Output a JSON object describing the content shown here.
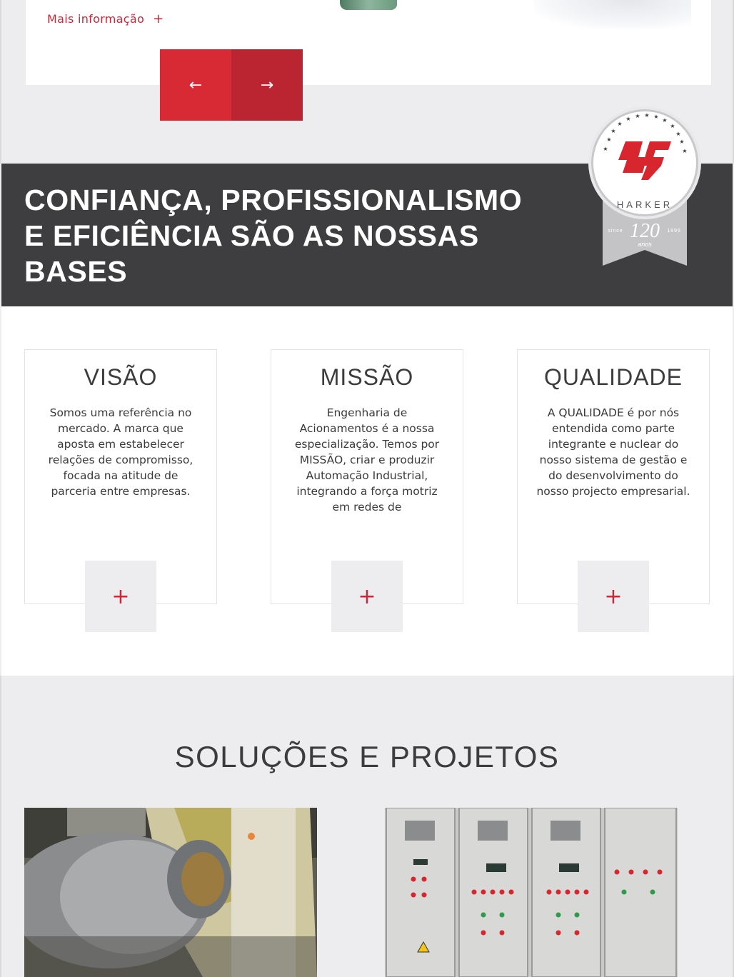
{
  "slider": {
    "more_label": "Mais informação",
    "more_plus": "+",
    "prev_arrow": "←",
    "next_arrow": "→"
  },
  "banner": {
    "title_line1": "CONFIANÇA, PROFISSIONALISMO",
    "title_line2": "E EFICIÊNCIA SÃO AS NOSSAS",
    "title_line3": "BASES"
  },
  "badge": {
    "brand": "HARKER",
    "since_label": "since",
    "number": "120",
    "year": "1896",
    "years_label": "anos",
    "brand_color": "#d8262e"
  },
  "values": [
    {
      "title": "VISÃO",
      "text": "Somos uma referência no mercado. A marca que aposta em estabelecer relações de compromisso, focada na atitude de parceria entre empresas.",
      "plus": "+"
    },
    {
      "title": "MISSÃO",
      "text": "Engenharia de Acionamentos é a nossa especialização. Temos por MISSÃO, criar e produzir Automação Industrial, integrando a força motriz em redes de",
      "plus": "+"
    },
    {
      "title": "QUALIDADE",
      "text": "A QUALIDADE é por nós entendida como parte integrante e nuclear do nosso sistema de gestão e do desenvolvimento do nosso projecto empresarial.",
      "plus": "+"
    }
  ],
  "solutions": {
    "title": "SOLUÇÕES E PROJETOS"
  },
  "colors": {
    "accent": "#c8283a",
    "arrow_prev": "#d82a34",
    "arrow_next": "#bb2431",
    "banner_bg": "#3e3e40",
    "page_bg": "#ededef"
  }
}
